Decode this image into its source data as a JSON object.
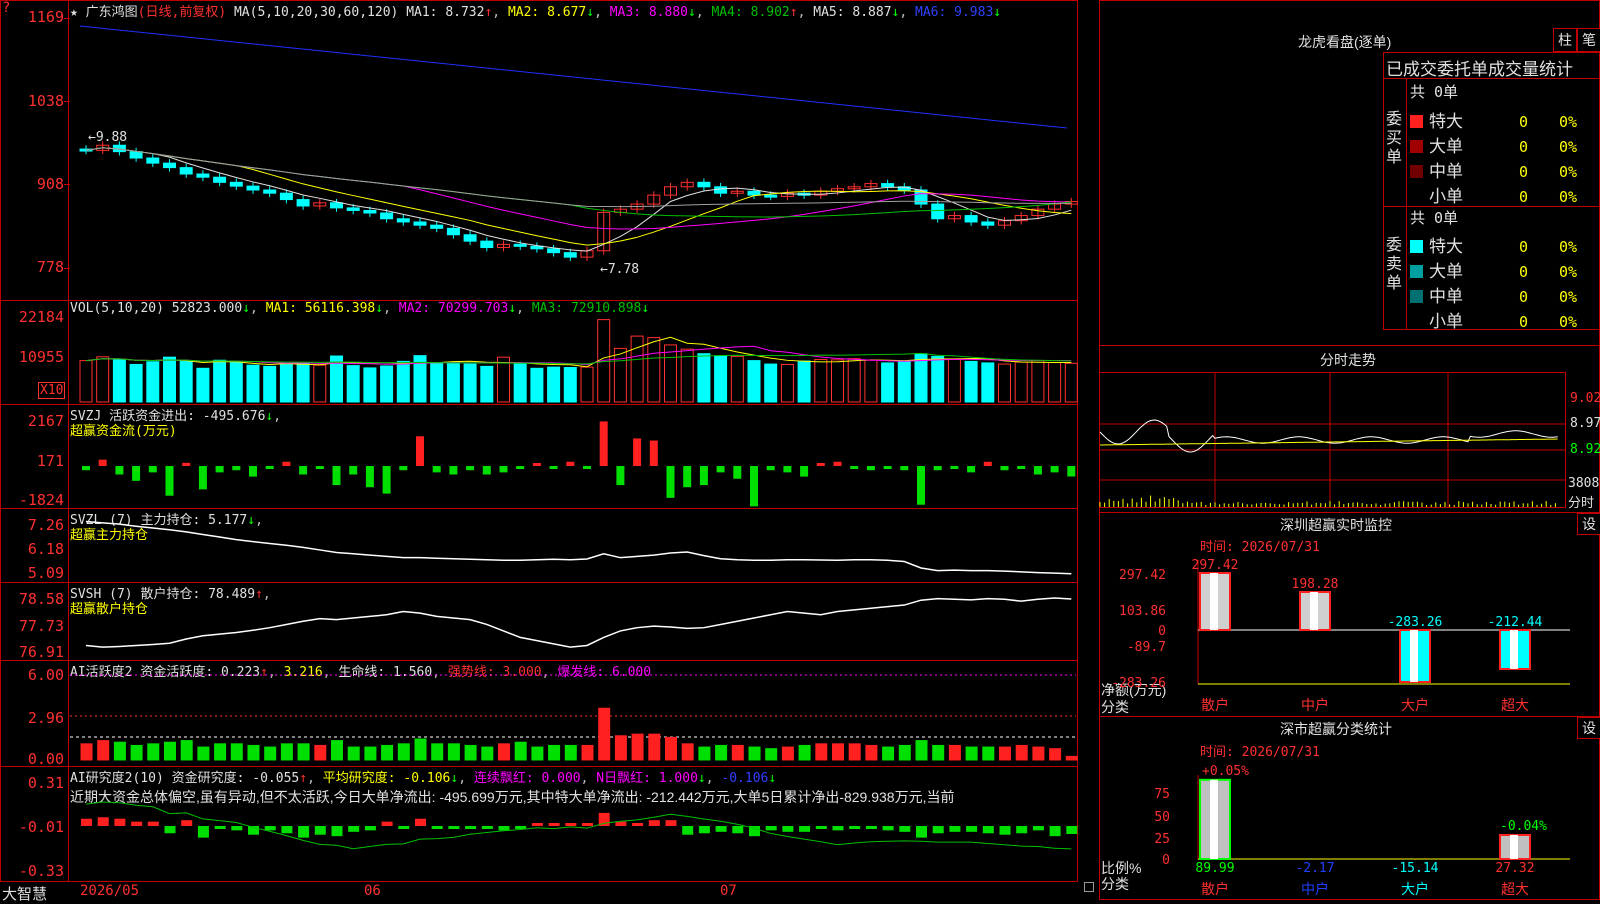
{
  "header": {
    "title": "广东鸿图",
    "period": "(日线,前复权)",
    "ma_label": "MA(5,10,20,30,60,120)",
    "ma1": "MA1: 8.732",
    "ma2": "MA2: 8.677",
    "ma3": "MA3: 8.880",
    "ma4": "MA4: 8.902",
    "ma5": "MA5: 8.887",
    "ma6": "MA6: 9.983",
    "arrow_up": "↑",
    "arrow_down": "↓",
    "question": "?",
    "star": "★"
  },
  "price_axis": [
    "1169",
    "1038",
    "908",
    "778"
  ],
  "price_annotations": {
    "high": "←9.88",
    "low": "←7.78"
  },
  "vol_panel": {
    "label": "VOL(5,10,20)",
    "value": "52823.000",
    "ma1": "MA1: 56116.398",
    "ma2": "MA2: 70299.703",
    "ma3": "MA3: 72910.898",
    "axis": [
      "22184",
      "10955"
    ],
    "unit": "X10"
  },
  "svzj_panel": {
    "label": "SVZJ",
    "text": "活跃资金进出: -495.676",
    "sub": "超赢资金流(万元)",
    "axis": [
      "2167",
      "171",
      "-1824"
    ]
  },
  "svzl_panel": {
    "label": "SVZL (7)",
    "text": "主力持仓: 5.177",
    "sub": "超赢主力持仓",
    "axis": [
      "7.26",
      "6.18",
      "5.09"
    ]
  },
  "svsh_panel": {
    "label": "SVSH (7)",
    "text": "散户持仓: 78.489",
    "sub": "超赢散户持仓",
    "axis": [
      "78.58",
      "77.73",
      "76.91"
    ]
  },
  "ai_active": {
    "label": "AI活跃度2",
    "text": "资金活跃度: 0.223",
    "v2": "3.216",
    "life": "生命线: 1.560",
    "strong": "强势线: 3.000",
    "burst": "爆发线: 6.000",
    "axis": [
      "6.00",
      "2.96",
      "0.00"
    ]
  },
  "ai_research": {
    "label": "AI研究度2(10)",
    "text": "资金研究度: -0.055",
    "avg": "平均研究度: -0.106",
    "cont": "连续飘红: 0.000",
    "nday": "N日飘红: 1.000",
    "last": "-0.106",
    "comment": "近期大资金总体偏空,虽有异动,但不太活跃,今日大单净流出: -495.699万元,其中特大单净流出: -212.442万元,大单5日累计净出-829.938万元,当前",
    "axis": [
      "0.31",
      "-0.01",
      "-0.33"
    ]
  },
  "date_axis": {
    "brand": "大智慧",
    "d1": "2026/05",
    "d2": "06",
    "d3": "07"
  },
  "dragon": {
    "title": "龙虎看盘(逐单)",
    "btn1": "柱",
    "btn2": "笔",
    "tabs": "已成交委托单成交量统计",
    "buy_label": "委买单",
    "sell_label": "委卖单",
    "buy_total": "共 0单",
    "sell_total": "共 0单",
    "rows_buy": [
      {
        "name": "特大",
        "count": "0",
        "pct": "0%",
        "color": "#ff2020"
      },
      {
        "name": "大单",
        "count": "0",
        "pct": "0%",
        "color": "#a00000"
      },
      {
        "name": "中单",
        "count": "0",
        "pct": "0%",
        "color": "#700000"
      },
      {
        "name": "小单",
        "count": "0",
        "pct": "0%",
        "color": "#000000"
      }
    ],
    "rows_sell": [
      {
        "name": "特大",
        "count": "0",
        "pct": "0%",
        "color": "#00ffff"
      },
      {
        "name": "大单",
        "count": "0",
        "pct": "0%",
        "color": "#00a0a0"
      },
      {
        "name": "中单",
        "count": "0",
        "pct": "0%",
        "color": "#007070"
      },
      {
        "name": "小单",
        "count": "0",
        "pct": "0%",
        "color": "#000000"
      }
    ]
  },
  "intraday": {
    "title": "分时走势",
    "axis": [
      "9.02",
      "8.97",
      "8.92",
      "3808",
      "分时"
    ]
  },
  "sz_monitor": {
    "title": "深圳超赢实时监控",
    "btn": "设",
    "time": "时间: 2026/07/31",
    "axis": [
      "297.42",
      "103.86",
      "0",
      "-89.7",
      "-283.26"
    ],
    "ylabel": "净额(万元)",
    "xlabel": "分类",
    "bars": [
      {
        "name": "散户",
        "value": "297.42"
      },
      {
        "name": "中户",
        "value": "198.28"
      },
      {
        "name": "大户",
        "value": "-283.26"
      },
      {
        "name": "超大",
        "value": "-212.44"
      }
    ]
  },
  "sz_class": {
    "title": "深市超赢分类统计",
    "btn": "设",
    "time": "时间: 2026/07/31",
    "axis": [
      "75",
      "50",
      "25",
      "0"
    ],
    "ylabel": "比例%",
    "xlabel": "分类",
    "top1": "+0.05%",
    "top4": "-0.04%",
    "bars": [
      {
        "name": "散户",
        "value": "89.99"
      },
      {
        "name": "中户",
        "value": "-2.17"
      },
      {
        "name": "大户",
        "value": "-15.14"
      },
      {
        "name": "超大",
        "value": "27.32"
      }
    ]
  },
  "chart_data": [
    {
      "type": "candlestick",
      "title": "广东鸿图(日线,前复权)",
      "ylim": [
        7.78,
        11.69
      ],
      "axis_ticks": [
        "1169",
        "1038",
        "908",
        "778"
      ],
      "close": [
        9.62,
        9.7,
        9.6,
        9.5,
        9.42,
        9.35,
        9.25,
        9.2,
        9.12,
        9.06,
        9.0,
        8.95,
        8.85,
        8.75,
        8.8,
        8.72,
        8.68,
        8.64,
        8.55,
        8.5,
        8.45,
        8.4,
        8.3,
        8.2,
        8.1,
        8.15,
        8.12,
        8.08,
        8.02,
        7.95,
        8.05,
        8.65,
        8.7,
        8.78,
        8.92,
        9.05,
        9.12,
        9.05,
        8.95,
        8.98,
        8.92,
        8.9,
        8.95,
        8.92,
        8.98,
        9.02,
        9.05,
        9.1,
        9.05,
        9.0,
        8.78,
        8.55,
        8.6,
        8.5,
        8.45,
        8.52,
        8.6,
        8.7,
        8.78,
        8.82
      ]
    },
    {
      "type": "bar",
      "title": "VOL(5,10,20)",
      "values": [
        10800,
        11800,
        11200,
        9800,
        10500,
        11700,
        10800,
        8800,
        10900,
        10300,
        9600,
        9300,
        9900,
        10200,
        9600,
        12000,
        9500,
        8900,
        9400,
        10600,
        12100,
        10200,
        10400,
        9900,
        9300,
        11700,
        10000,
        8800,
        9100,
        9000,
        9100,
        21500,
        14000,
        17200,
        16800,
        14900,
        13800,
        12600,
        12000,
        11900,
        10800,
        9900,
        9800,
        10700,
        11100,
        11000,
        11300,
        10900,
        10200,
        10500,
        12600,
        11900,
        11100,
        10600,
        10200,
        9900,
        10400,
        10800,
        10300,
        10100
      ]
    },
    {
      "type": "bar",
      "title": "SVZJ 活跃资金进出",
      "values": [
        -200,
        300,
        -400,
        -700,
        -300,
        -1400,
        150,
        -1100,
        -300,
        -200,
        -500,
        -50,
        200,
        -400,
        -100,
        -900,
        -400,
        -1000,
        -1300,
        -200,
        1400,
        -300,
        -400,
        -200,
        -400,
        -300,
        -100,
        100,
        -100,
        200,
        -100,
        2100,
        -900,
        1300,
        1200,
        -1500,
        -1000,
        -900,
        -300,
        -600,
        -1900,
        -200,
        -300,
        -500,
        100,
        200,
        -100,
        -200,
        -100,
        -200,
        -1824,
        -200,
        -100,
        -300,
        200,
        -200,
        -100,
        -400,
        -300,
        -495.676
      ]
    },
    {
      "type": "line",
      "title": "SVZL 主力持仓",
      "ylim": [
        5.09,
        7.26
      ],
      "values": [
        7.2,
        7.15,
        7.1,
        7.02,
        6.95,
        6.88,
        6.8,
        6.7,
        6.6,
        6.5,
        6.42,
        6.35,
        6.28,
        6.2,
        6.1,
        6.0,
        5.95,
        5.9,
        5.85,
        5.8,
        5.8,
        5.78,
        5.76,
        5.74,
        5.72,
        5.7,
        5.7,
        5.72,
        5.74,
        5.72,
        5.75,
        5.95,
        5.8,
        5.85,
        5.9,
        5.98,
        6.02,
        5.88,
        5.76,
        5.72,
        5.7,
        5.7,
        5.72,
        5.72,
        5.71,
        5.7,
        5.72,
        5.72,
        5.7,
        5.65,
        5.4,
        5.3,
        5.32,
        5.3,
        5.3,
        5.28,
        5.25,
        5.22,
        5.2,
        5.177
      ]
    },
    {
      "type": "line",
      "title": "SVSH 散户持仓",
      "ylim": [
        76.91,
        78.58
      ],
      "values": [
        77.05,
        77.0,
        77.02,
        77.05,
        77.08,
        77.12,
        77.25,
        77.35,
        77.4,
        77.45,
        77.52,
        77.6,
        77.7,
        77.8,
        77.88,
        77.85,
        77.9,
        77.95,
        78.0,
        78.1,
        78.05,
        77.95,
        77.9,
        77.85,
        77.7,
        77.5,
        77.3,
        77.2,
        77.1,
        77.0,
        77.05,
        77.3,
        77.5,
        77.6,
        77.65,
        77.62,
        77.58,
        77.6,
        77.7,
        77.8,
        77.9,
        78.0,
        78.1,
        78.05,
        78.0,
        78.1,
        78.15,
        78.2,
        78.25,
        78.3,
        78.45,
        78.5,
        78.48,
        78.46,
        78.5,
        78.48,
        78.42,
        78.48,
        78.52,
        78.489
      ]
    },
    {
      "type": "bar",
      "title": "AI活跃度2",
      "ylim": [
        0,
        6
      ],
      "values": [
        1.0,
        1.2,
        1.1,
        0.9,
        1.0,
        1.1,
        1.2,
        0.8,
        1.0,
        1.0,
        0.9,
        0.8,
        1.0,
        1.0,
        0.9,
        1.2,
        0.8,
        0.8,
        0.9,
        1.0,
        1.3,
        1.0,
        1.0,
        0.9,
        0.8,
        1.0,
        1.1,
        0.8,
        0.9,
        0.9,
        0.9,
        3.2,
        1.5,
        1.6,
        1.6,
        1.4,
        1.0,
        0.8,
        0.9,
        0.9,
        0.8,
        0.7,
        0.8,
        0.9,
        1.0,
        1.0,
        1.0,
        0.9,
        0.8,
        0.9,
        1.2,
        0.9,
        0.9,
        0.8,
        0.8,
        0.8,
        0.9,
        0.8,
        0.7,
        0.223
      ]
    },
    {
      "type": "bar",
      "title": "AI研究度2(10)",
      "ylim": [
        -0.33,
        0.31
      ],
      "values": [
        0.05,
        0.06,
        0.05,
        0.03,
        0.03,
        -0.05,
        0.04,
        -0.08,
        -0.02,
        -0.03,
        -0.06,
        -0.03,
        -0.05,
        -0.08,
        -0.06,
        -0.07,
        -0.04,
        -0.03,
        0.03,
        -0.02,
        0.05,
        -0.02,
        -0.02,
        -0.01,
        -0.02,
        -0.03,
        -0.01,
        0.01,
        0.01,
        0.02,
        0.02,
        0.09,
        0.03,
        0.02,
        0.04,
        0.04,
        -0.06,
        -0.05,
        -0.04,
        -0.05,
        -0.07,
        -0.03,
        -0.04,
        -0.04,
        -0.02,
        -0.03,
        -0.02,
        -0.02,
        -0.03,
        -0.04,
        -0.08,
        -0.05,
        -0.04,
        -0.04,
        -0.05,
        -0.06,
        -0.05,
        -0.03,
        -0.07,
        -0.055
      ]
    }
  ]
}
